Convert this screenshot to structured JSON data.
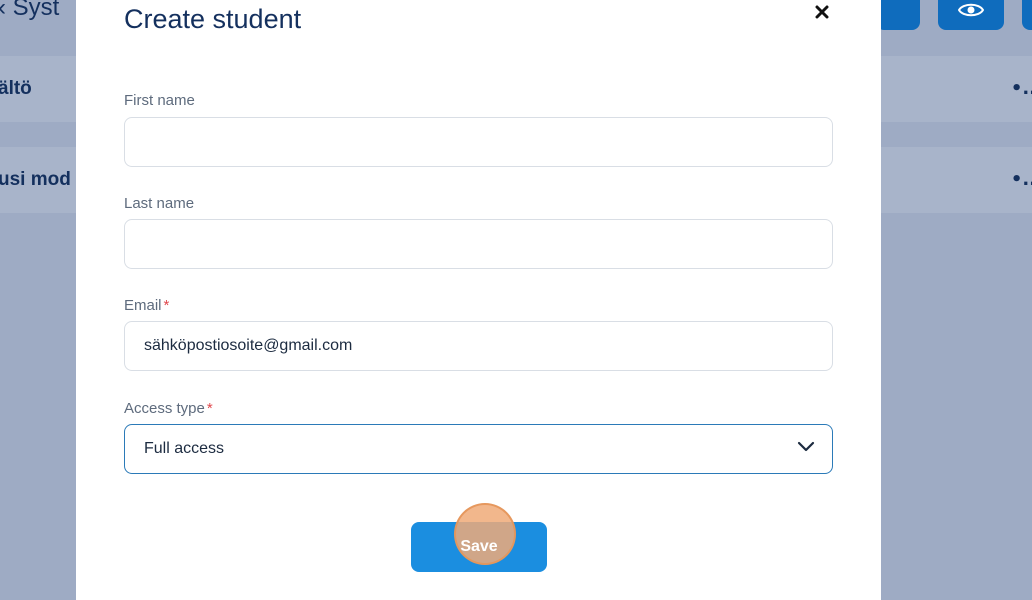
{
  "background": {
    "title": "Syst",
    "rows": [
      {
        "label": "ältö",
        "dots": "•.."
      },
      {
        "label": "usi mod",
        "dots": "•.."
      }
    ],
    "colors": {
      "accent": "#0f6cbd",
      "text": "#14305e"
    }
  },
  "modal": {
    "title": "Create student",
    "close_glyph": "×",
    "fields": {
      "first_name": {
        "label": "First name",
        "value": ""
      },
      "last_name": {
        "label": "Last name",
        "value": ""
      },
      "email": {
        "label": "Email",
        "required_mark": "*",
        "value": "sähköpostiosoite@gmail.com"
      },
      "access_type": {
        "label": "Access type",
        "required_mark": "*",
        "selected": "Full access"
      }
    },
    "save_label": "Save"
  }
}
